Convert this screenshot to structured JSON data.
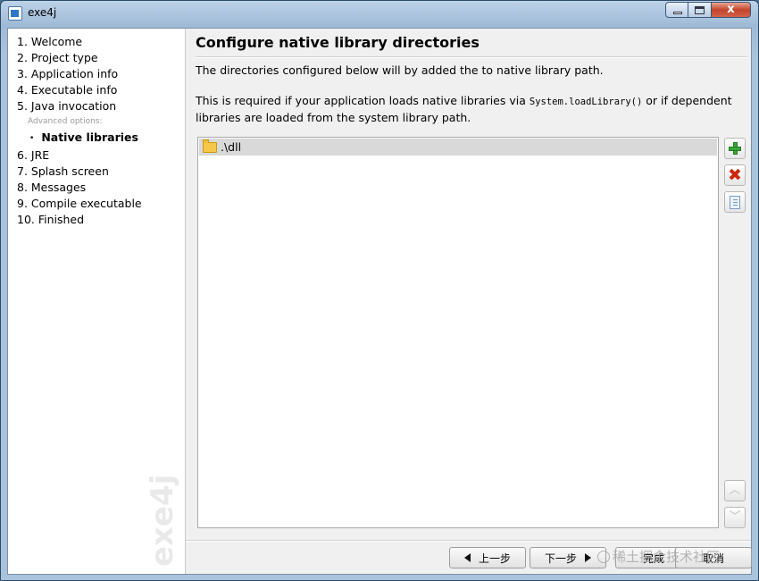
{
  "window": {
    "title": "exe4j",
    "controls": {
      "minimize": "",
      "maximize": "",
      "close": "x"
    }
  },
  "sidebar": {
    "steps": [
      {
        "label": "1. Welcome"
      },
      {
        "label": "2. Project type"
      },
      {
        "label": "3. Application info"
      },
      {
        "label": "4. Executable info"
      },
      {
        "label": "5. Java invocation"
      }
    ],
    "advanced_header": "Advanced options:",
    "active_item": "Native libraries",
    "steps_after": [
      {
        "label": "6. JRE"
      },
      {
        "label": "7. Splash screen"
      },
      {
        "label": "8. Messages"
      },
      {
        "label": "9. Compile executable"
      },
      {
        "label": "10. Finished"
      }
    ],
    "watermark": "exe4j"
  },
  "main": {
    "title": "Configure native library directories",
    "description_1": "The directories configured below will by added the to native library path.",
    "description_2_pre": "This is required if your application loads native libraries via ",
    "description_2_code": "System.loadLibrary()",
    "description_2_post": " or if dependent libraries are loaded from the system library path.",
    "directories": [
      {
        "path": ".\\dll",
        "icon": "folder-icon"
      }
    ],
    "side_buttons": {
      "add": {
        "icon": "plus-icon",
        "color": "#3aa63a"
      },
      "remove": {
        "icon": "remove-icon",
        "glyph": "✖",
        "color": "#cc2a10"
      },
      "copy": {
        "icon": "copy-icon"
      },
      "move_up": {
        "icon": "arrow-up-icon",
        "glyph": "︿"
      },
      "move_down": {
        "icon": "arrow-down-icon",
        "glyph": "﹀"
      }
    }
  },
  "footer": {
    "back_label": "上一步",
    "next_label": "下一步",
    "finish_label": "完成",
    "cancel_label": "取消"
  },
  "overlay": {
    "text": "稀土掘金技术社区"
  }
}
